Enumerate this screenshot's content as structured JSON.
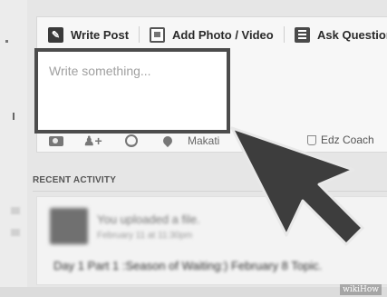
{
  "composer": {
    "tabs": [
      {
        "label": "Write Post",
        "icon": "pencil-icon"
      },
      {
        "label": "Add Photo / Video",
        "icon": "photo-icon"
      },
      {
        "label": "Ask Question",
        "icon": "list-icon"
      }
    ],
    "post_input": {
      "placeholder": "Write something..."
    },
    "toolbar": {
      "location_label": "Makati",
      "friend_label": "Edz Coach"
    }
  },
  "recent_activity": {
    "header": "RECENT ACTIVITY",
    "item": {
      "title": "You uploaded a file.",
      "time": "February 11 at 11:30pm",
      "post_text": "Day 1 Part 1 :Season of Waiting:) February 8 Topic."
    }
  },
  "watermark": "wikiHow",
  "colors": {
    "highlight_border": "#4c4c4c",
    "arrow": "#3d3d3d"
  }
}
